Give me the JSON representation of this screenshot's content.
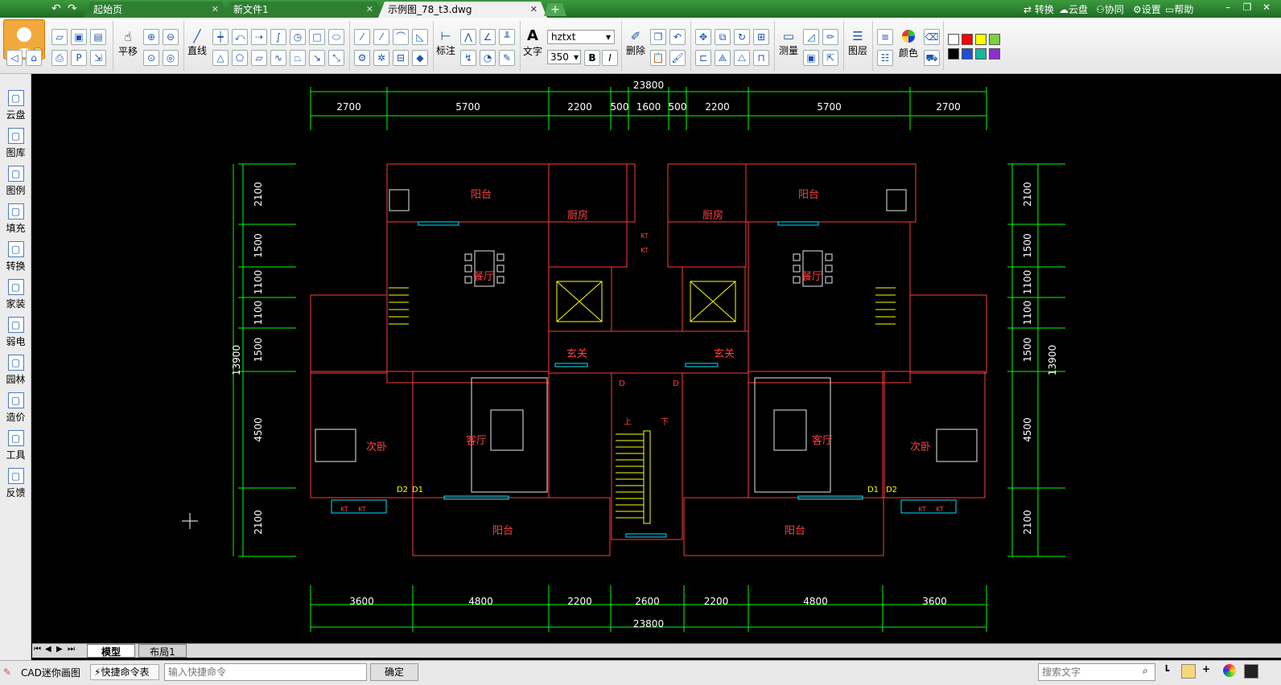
{
  "titlebar": {
    "tabs": [
      {
        "label": "起始页"
      },
      {
        "label": "新文件1"
      },
      {
        "label": "示例图_78_t3.dwg"
      }
    ],
    "add_label": "+",
    "nav": [
      "转换",
      "云盘",
      "协同",
      "设置",
      "帮助"
    ]
  },
  "toolbar": {
    "pan_label": "平移",
    "line_label": "直线",
    "dim_label": "标注",
    "text_label": "文字",
    "font_name": "hztxt",
    "font_size": "350",
    "bold": "B",
    "italic": "I",
    "delete_label": "删除",
    "measure_label": "测量",
    "layer_label": "图层",
    "color_label": "颜色",
    "swatches": [
      "#ffffff",
      "#ff0000",
      "#ffff00",
      "#7dd13f",
      "#000000",
      "#1f4fd6",
      "#19b3a2",
      "#8b2fd0"
    ]
  },
  "sidebar": {
    "items": [
      {
        "label": "云盘",
        "icon": "cloud-icon"
      },
      {
        "label": "图库",
        "icon": "gallery-icon"
      },
      {
        "label": "图例",
        "icon": "legend-icon"
      },
      {
        "label": "填充",
        "icon": "hatch-icon"
      },
      {
        "label": "转换",
        "icon": "convert-icon"
      },
      {
        "label": "家装",
        "icon": "home-icon"
      },
      {
        "label": "弱电",
        "icon": "low-voltage-icon"
      },
      {
        "label": "园林",
        "icon": "garden-icon"
      },
      {
        "label": "造价",
        "icon": "cost-icon"
      },
      {
        "label": "工具",
        "icon": "tools-icon"
      },
      {
        "label": "反馈",
        "icon": "feedback-icon"
      }
    ]
  },
  "drawing": {
    "total_width": "23800",
    "total_height": "13900",
    "top_dims": [
      "2700",
      "5700",
      "2200",
      "500",
      "1600",
      "500",
      "2200",
      "5700",
      "2700"
    ],
    "bottom_dims": [
      "3600",
      "4800",
      "2200",
      "2600",
      "2200",
      "4800",
      "3600"
    ],
    "side_dims": [
      "2100",
      "1500",
      "1100",
      "1100",
      "1500",
      "4500",
      "2100"
    ],
    "rooms": {
      "balcony": "阳台",
      "kitchen": "厨房",
      "dining": "餐厅",
      "foyer": "玄关",
      "living": "客厅",
      "bedroom": "次卧",
      "up": "上",
      "down": "下",
      "d": "D",
      "d1": "D1",
      "d2": "D2",
      "kt": "KT"
    }
  },
  "layout_tabs": [
    "模型",
    "布局1"
  ],
  "status": {
    "app_name": "CAD迷你画图",
    "shortcut_table": "快捷命令表",
    "cmd_placeholder": "输入快捷命令",
    "ok_label": "确定",
    "search_placeholder": "搜索文字"
  }
}
